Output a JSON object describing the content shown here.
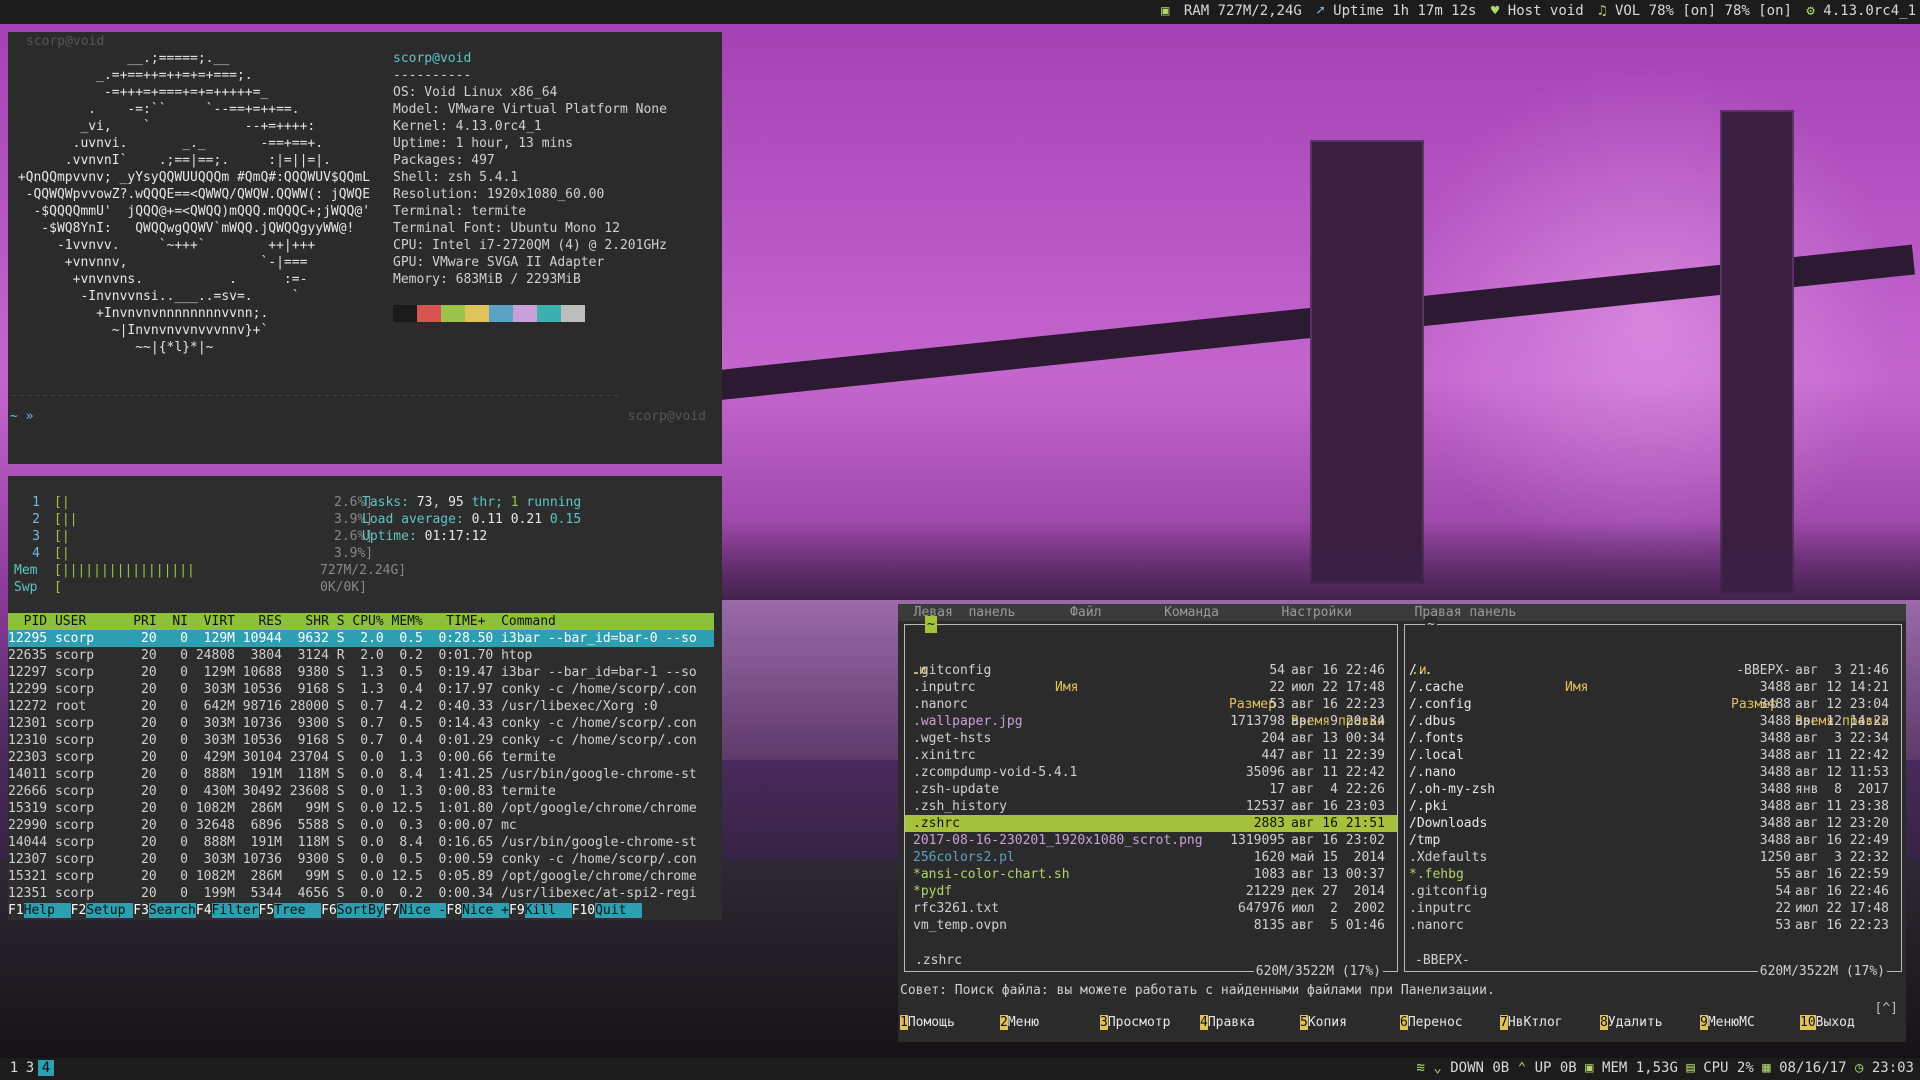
{
  "topbar": {
    "ram": "RAM 727M/2,24G",
    "uptime": "Uptime 1h 17m 12s",
    "host": "Host void",
    "vol": "VOL 78% [on] 78% [on]",
    "kernel": "4.13.0rc4_1"
  },
  "neofetch": {
    "title": "scorp@void",
    "art": "               __.;=====;.__\n           _.=+==++=++=+=+===;.\n            -=+++=+===+=+=+++++=_\n          .    -=:``     `--==+=++==.\n         _vi,    `            --+=++++:\n        .uvnvi.       _._       -==+==+.\n       .vvnvnI`    .;==|==;.     :|=||=|.\n +QnQQmpvvnv; _yYsyQQWUUQQQm #QmQ#:QQQWUV$QQmL\n  -QQWQWpvvowZ?.wQQQE==<QWWQ/QWQW.QQWW(: jQWQE\n   -$QQQQmmU'  jQQQ@+=<QWQQ)mQQQ.mQQQC+;jWQQ@'\n    -$WQ8YnI:   QWQQwgQQWV`mWQQ.jQWQQgyyWW@!\n      -1vvnvv.     `~+++`        ++|+++\n       +vnvnnv,                 `-|===\n        +vnvnvns.           .      :=-\n         -Invnvvnsi..___..=sv=.     `\n           +Invnvnvnnnnnnnnvvnn;.\n             ~|Invnvnvvnvvvnnv}+`\n                ~~|{*l}*|~",
    "user": "scorp@void",
    "sep": "----------",
    "lines": [
      "OS: Void Linux x86_64",
      "Model: VMware Virtual Platform None",
      "Kernel: 4.13.0rc4_1",
      "Uptime: 1 hour, 13 mins",
      "Packages: 497",
      "Shell: zsh 5.4.1",
      "Resolution: 1920x1080_60.00",
      "Terminal: termite",
      "Terminal Font: Ubuntu Mono 12",
      "CPU: Intel i7-2720QM (4) @ 2.201GHz",
      "GPU: VMware SVGA II Adapter",
      "Memory: 683MiB / 2293MiB"
    ],
    "palette": [
      "#1a1a1a",
      "#d9534f",
      "#9bc34d",
      "#e0c25a",
      "#5aa1c4",
      "#c7a0d9",
      "#3fb0b0",
      "#bdbdbd"
    ],
    "prompt": "~ »",
    "rprompt": "scorp@void"
  },
  "htop": {
    "cpu": [
      {
        "n": "1",
        "bar": "[|",
        "pct": "2.6%]"
      },
      {
        "n": "2",
        "bar": "[||",
        "pct": "3.9%]"
      },
      {
        "n": "3",
        "bar": "[|",
        "pct": "2.6%]"
      },
      {
        "n": "4",
        "bar": "[|",
        "pct": "3.9%]"
      }
    ],
    "mem": {
      "label": "Mem",
      "bar": "[|||||||||||||||||",
      "val": "727M/2.24G]"
    },
    "swp": {
      "label": "Swp",
      "bar": "[",
      "val": "0K/0K]"
    },
    "tasks_label": "Tasks:",
    "tasks": "73",
    "thr": "95",
    "thr_label": "thr;",
    "running": "1",
    "running_label": "running",
    "load_label": "Load average:",
    "load1": "0.11",
    "load5": "0.21",
    "load15": "0.15",
    "uptime_label": "Uptime:",
    "uptime": "01:17:12",
    "header": "  PID USER      PRI  NI  VIRT   RES   SHR S CPU% MEM%   TIME+  Command",
    "rows": [
      "12295 scorp      20   0  129M 10944  9632 S  2.0  0.5  0:28.50 i3bar --bar_id=bar-0 --so",
      "22635 scorp      20   0 24808  3804  3124 R  2.0  0.2  0:01.70 htop",
      "12297 scorp      20   0  129M 10688  9380 S  1.3  0.5  0:19.47 i3bar --bar_id=bar-1 --so",
      "12299 scorp      20   0  303M 10536  9168 S  1.3  0.4  0:17.97 conky -c /home/scorp/.con",
      "12272 root       20   0  642M 98716 28000 S  0.7  4.2  0:40.33 /usr/libexec/Xorg :0",
      "12301 scorp      20   0  303M 10736  9300 S  0.7  0.5  0:14.43 conky -c /home/scorp/.con",
      "12310 scorp      20   0  303M 10536  9168 S  0.7  0.4  0:01.29 conky -c /home/scorp/.con",
      "22303 scorp      20   0  429M 30104 23704 S  0.0  1.3  0:00.66 termite",
      "14011 scorp      20   0  888M  191M  118M S  0.0  8.4  1:41.25 /usr/bin/google-chrome-st",
      "22666 scorp      20   0  430M 30492 23608 S  0.0  1.3  0:00.83 termite",
      "15319 scorp      20   0 1082M  286M   99M S  0.0 12.5  1:01.80 /opt/google/chrome/chrome",
      "22990 scorp      20   0 32648  6896  5588 S  0.0  0.3  0:00.07 mc",
      "14044 scorp      20   0  888M  191M  118M S  0.0  8.4  0:16.65 /usr/bin/google-chrome-st",
      "12307 scorp      20   0  303M 10736  9300 S  0.0  0.5  0:00.59 conky -c /home/scorp/.con",
      "15321 scorp      20   0 1082M  286M   99M S  0.0 12.5  0:05.89 /opt/google/chrome/chrome",
      "12351 scorp      20   0  199M  5344  4656 S  0.0  0.2  0:00.34 /usr/libexec/at-spi2-regi"
    ],
    "fkeys": [
      {
        "k": "F1",
        "l": "Help  "
      },
      {
        "k": "F2",
        "l": "Setup "
      },
      {
        "k": "F3",
        "l": "Search"
      },
      {
        "k": "F4",
        "l": "Filter"
      },
      {
        "k": "F5",
        "l": "Tree  "
      },
      {
        "k": "F6",
        "l": "SortBy"
      },
      {
        "k": "F7",
        "l": "Nice -"
      },
      {
        "k": "F8",
        "l": "Nice +"
      },
      {
        "k": "F9",
        "l": "Kill  "
      },
      {
        "k": "F10",
        "l": "Quit  "
      }
    ]
  },
  "mc": {
    "menu": "  Левая  панель       Файл        Команда        Настройки        Правая панель",
    "left": {
      "path": "~",
      "col_name": "Имя",
      "col_size": "Размер",
      "col_time": "Время правки",
      "col_head": ".и",
      "rows": [
        {
          "name": ".gitconfig",
          "size": "54",
          "time": "авг 16 22:46"
        },
        {
          "name": ".inputrc",
          "size": "22",
          "time": "июл 22 17:48"
        },
        {
          "name": ".nanorc",
          "size": "53",
          "time": "авг 16 22:23"
        },
        {
          "name": ".wallpaper.jpg",
          "size": "1713798",
          "time": "авг  9 20:34"
        },
        {
          "name": ".wget-hsts",
          "size": "204",
          "time": "авг 13 00:34"
        },
        {
          "name": ".xinitrc",
          "size": "447",
          "time": "авг 11 22:39"
        },
        {
          "name": ".zcompdump-void-5.4.1",
          "size": "35096",
          "time": "авг 11 22:42"
        },
        {
          "name": ".zsh-update",
          "size": "17",
          "time": "авг  4 22:26"
        },
        {
          "name": ".zsh_history",
          "size": "12537",
          "time": "авг 16 23:03"
        },
        {
          "name": ".zshrc",
          "size": "2883",
          "time": "авг 16 21:51"
        },
        {
          "name": "2017-08-16-230201_1920x1080_scrot.png",
          "size": "1319095",
          "time": "авг 16 23:02"
        },
        {
          "name": "256colors2.pl",
          "size": "1620",
          "time": "май 15  2014"
        },
        {
          "name": "*ansi-color-chart.sh",
          "size": "1083",
          "time": "авг 13 00:37"
        },
        {
          "name": "*pydf",
          "size": "21229",
          "time": "дек 27  2014"
        },
        {
          "name": "rfc3261.txt",
          "size": "647976",
          "time": "июл  2  2002"
        },
        {
          "name": "vm_temp.ovpn",
          "size": "8135",
          "time": "авг  5 01:46"
        }
      ],
      "selected": ".zshrc",
      "disk": "620M/3522M (17%)"
    },
    "right": {
      "path": "~",
      "col_name": "Имя",
      "col_size": "Размер",
      "col_time": "Время правки",
      "col_head": ".и",
      "rows": [
        {
          "name": "/..",
          "size": "-ВВЕРХ-",
          "time": "авг  3 21:46"
        },
        {
          "name": "/.cache",
          "size": "3488",
          "time": "авг 12 14:21"
        },
        {
          "name": "/.config",
          "size": "3488",
          "time": "авг 12 23:04"
        },
        {
          "name": "/.dbus",
          "size": "3488",
          "time": "авг 12 14:23"
        },
        {
          "name": "/.fonts",
          "size": "3488",
          "time": "авг  3 22:34"
        },
        {
          "name": "/.local",
          "size": "3488",
          "time": "авг 11 22:42"
        },
        {
          "name": "/.nano",
          "size": "3488",
          "time": "авг 12 11:53"
        },
        {
          "name": "/.oh-my-zsh",
          "size": "3488",
          "time": "янв  8  2017"
        },
        {
          "name": "/.pki",
          "size": "3488",
          "time": "авг 11 23:38"
        },
        {
          "name": "/Downloads",
          "size": "3488",
          "time": "авг 12 23:20"
        },
        {
          "name": "/tmp",
          "size": "3488",
          "time": "авг 16 22:49"
        },
        {
          "name": ".Xdefaults",
          "size": "1250",
          "time": "авг  3 22:32"
        },
        {
          "name": "*.fehbg",
          "size": "55",
          "time": "авг 16 22:59"
        },
        {
          "name": ".gitconfig",
          "size": "54",
          "time": "авг 16 22:46"
        },
        {
          "name": ".inputrc",
          "size": "22",
          "time": "июл 22 17:48"
        },
        {
          "name": ".nanorc",
          "size": "53",
          "time": "авг 16 22:23"
        }
      ],
      "selected": "-ВВЕРХ-",
      "disk": "620M/3522M (17%)"
    },
    "hint": "Совет: Поиск файла: вы можете работать с найденными файлами при Панелизации.",
    "cmd_indicator": "[^]",
    "fbar": [
      {
        "n": "1",
        "l": "Помощь"
      },
      {
        "n": "2",
        "l": "Меню"
      },
      {
        "n": "3",
        "l": "Просмотр"
      },
      {
        "n": "4",
        "l": "Правка"
      },
      {
        "n": "5",
        "l": "Копия"
      },
      {
        "n": "6",
        "l": "Перенос"
      },
      {
        "n": "7",
        "l": "НвКтлог"
      },
      {
        "n": "8",
        "l": "Удалить"
      },
      {
        "n": "9",
        "l": "МенюМС"
      },
      {
        "n": "10",
        "l": "Выход"
      }
    ]
  },
  "botbar": {
    "workspaces": [
      "1",
      "3",
      "4"
    ],
    "active_workspace": "4",
    "down": "DOWN 0B",
    "up": "UP 0B",
    "mem": "MEM 1,53G",
    "cpu": "CPU 2%",
    "date": "08/16/17",
    "time": "23:03"
  },
  "colors": {
    "accent": "#2e9fb0",
    "htop_header": "#8dc13a",
    "mc_select": "#a6c23c",
    "mc_fkey": "#e0c25a"
  }
}
